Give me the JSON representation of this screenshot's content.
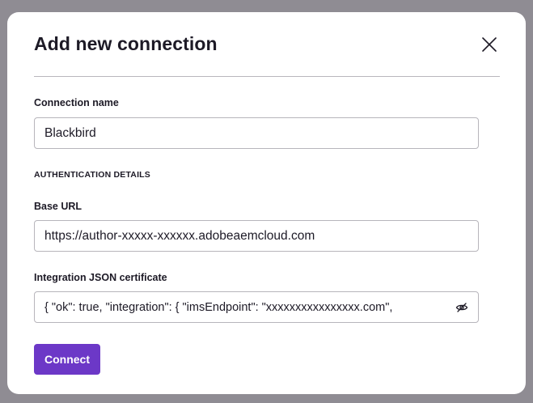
{
  "dialog": {
    "title": "Add new connection",
    "close_icon": "close-icon"
  },
  "form": {
    "connection_name": {
      "label": "Connection name",
      "value": "Blackbird"
    },
    "auth_section_label": "AUTHENTICATION DETAILS",
    "base_url": {
      "label": "Base URL",
      "value": "https://author-xxxxx-xxxxxx.adobeaemcloud.com"
    },
    "integration_json": {
      "label": "Integration JSON certificate",
      "value": "{  \"ok\": true,  \"integration\": {    \"imsEndpoint\": \"xxxxxxxxxxxxxxxx.com\",",
      "toggle_icon": "eye-off-icon"
    },
    "connect_label": "Connect"
  },
  "colors": {
    "accent": "#6c38c7",
    "text": "#1d1a26",
    "border": "#b7b5bb",
    "backdrop": "#8f8c93"
  }
}
